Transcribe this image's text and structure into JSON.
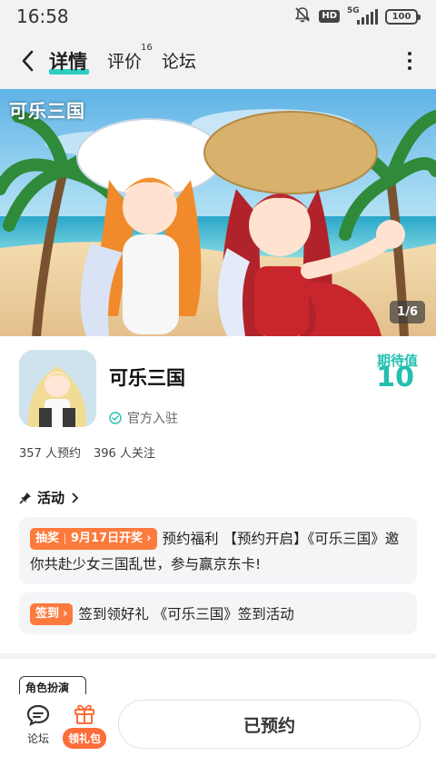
{
  "status_bar": {
    "time": "16:58",
    "hd": "HD",
    "network": "5G",
    "battery": "100",
    "icons": [
      "mute-bell-icon",
      "hd-icon",
      "signal-icon",
      "battery-icon"
    ]
  },
  "header": {
    "tabs": [
      {
        "label": "详情",
        "active": true
      },
      {
        "label": "评价",
        "count": "16"
      },
      {
        "label": "论坛"
      }
    ],
    "accent_color": "#2bcfc0"
  },
  "banner": {
    "logo_text": "可乐三国",
    "page_indicator": "1/6"
  },
  "app": {
    "name": "可乐三国",
    "official_label": "官方入驻",
    "expect_label": "期待值",
    "expect_value": "10",
    "reservations": "357 人预约",
    "followers": "396 人关注"
  },
  "activities": {
    "heading": "活动",
    "items": [
      {
        "tag": "抽奖",
        "sub_tag": "9月17日开奖",
        "text": "预约福利 【预约开启】《可乐三国》邀你共赴少女三国乱世，参与赢京东卡!"
      },
      {
        "tag": "签到",
        "text": "签到领好礼 《可乐三国》签到活动"
      }
    ]
  },
  "section_tag": "角色扮演",
  "bottom_bar": {
    "forum_label": "论坛",
    "gift_label": "领礼包",
    "reserve_button": "已预约"
  },
  "colors": {
    "teal": "#21c0b0",
    "orange": "#fc7a3c"
  }
}
